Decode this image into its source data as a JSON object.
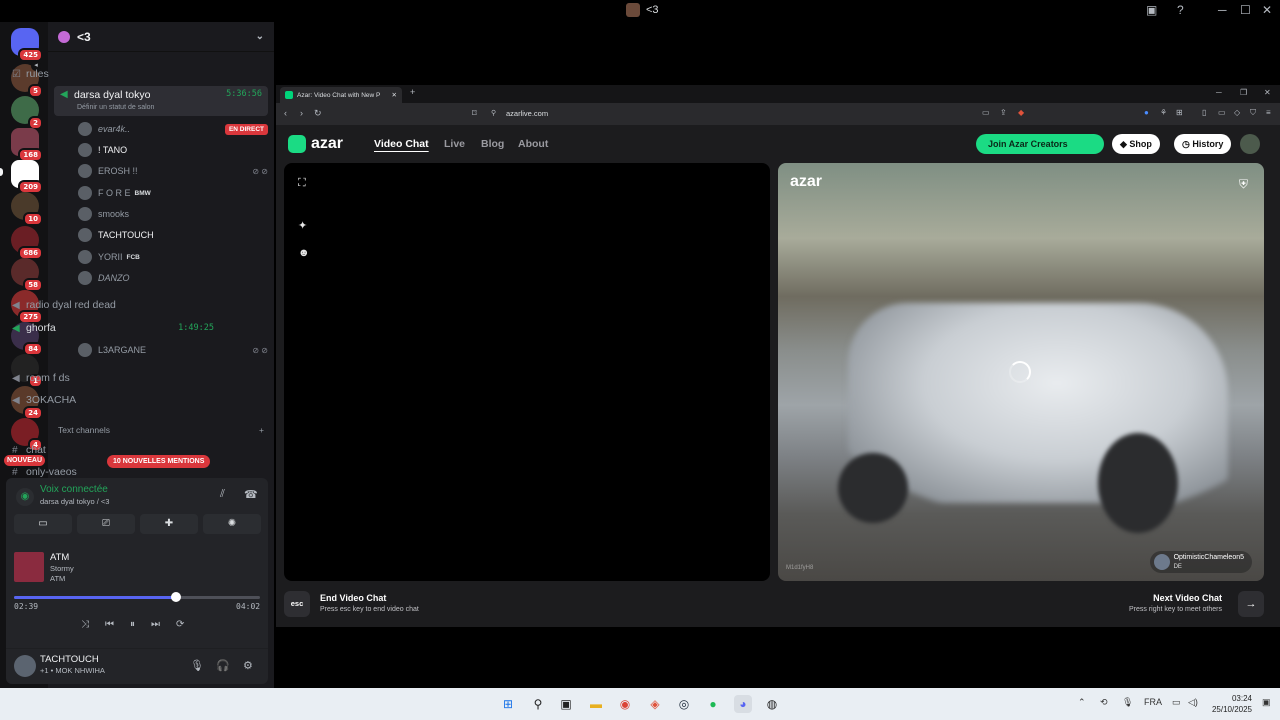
{
  "window": {
    "title": "<3"
  },
  "servers": [
    {
      "badge": "425"
    },
    {
      "badge": "5"
    },
    {
      "badge": "2"
    },
    {
      "badge": "168"
    },
    {
      "badge": "209"
    },
    {
      "badge": "10"
    },
    {
      "badge": "686"
    },
    {
      "badge": "58"
    },
    {
      "badge": "275"
    },
    {
      "badge": "84"
    },
    {
      "badge": "1"
    },
    {
      "badge": "24"
    },
    {
      "badge": "4"
    }
  ],
  "nouveau": "NOUVEAU",
  "guild": {
    "name": "<3"
  },
  "channels": {
    "rules": "rules",
    "active": {
      "name": "darsa dyal tokyo",
      "time": "5:36:56",
      "status": "Définir un statut de salon"
    },
    "active_users": [
      {
        "name": "evar4k..",
        "live": "EN DIRECT"
      },
      {
        "name": "! TANO"
      },
      {
        "name": "EROSH !!"
      },
      {
        "name": "F O R E",
        "tag": "BMW"
      },
      {
        "name": "smooks"
      },
      {
        "name": "TACHTOUCH"
      },
      {
        "name": "YORII",
        "tag": "FCB"
      },
      {
        "name": "DANZO"
      }
    ],
    "radio": "radio dyal red dead",
    "ghorfa": {
      "name": "ghorfa",
      "time": "1:49:25"
    },
    "ghorfa_user": "L3ARGANE",
    "room": "room f ds",
    "kacha": "3OKACHA",
    "text_category": "Text channels",
    "chat": "chat",
    "only": "only-vaeos",
    "mentions": "10 NOUVELLES MENTIONS"
  },
  "voice": {
    "status": "Voix connectée",
    "location": "darsa dyal tokyo / <3"
  },
  "music": {
    "title": "ATM",
    "artist": "Stormy",
    "album": "ATM",
    "elapsed": "02:39",
    "duration": "04:02",
    "progress": 0.658
  },
  "user": {
    "name": "TACHTOUCH",
    "status": "+1 • MOK NHWIHA"
  },
  "browser": {
    "tab_title": "Azar: Video Chat with New P",
    "url": "azarlive.com"
  },
  "azar": {
    "logo": "azar",
    "nav": [
      "Video Chat",
      "Live",
      "Blog",
      "About"
    ],
    "creators": "Join Azar Creators",
    "shop": "Shop",
    "history": "History",
    "peer_name": "OptimisticChameleon5",
    "peer_country": "DE",
    "watermark": "M1d1fyH8",
    "end_title": "End Video Chat",
    "end_sub": "Press esc key to end video chat",
    "esc": "esc",
    "next_title": "Next Video Chat",
    "next_sub": "Press right key to meet others"
  },
  "tray": {
    "lang": "FRA",
    "time": "03:24",
    "date": "25/10/2025"
  }
}
